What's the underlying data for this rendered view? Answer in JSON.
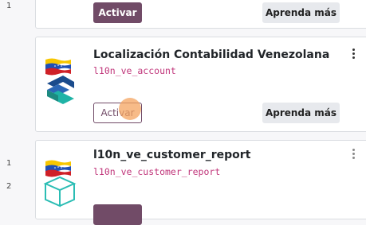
{
  "gutter": {
    "line_1": "1",
    "line_2": "1",
    "line_3": "2"
  },
  "cards": [
    {
      "activate_label": "Activar",
      "learn_more_label": "Aprenda más"
    },
    {
      "title": "Localización Contabilidad Venezolana",
      "technical_name": "l10n_ve_account",
      "activate_label": "Activar",
      "learn_more_label": "Aprenda más",
      "icon": "venezuela-flag-accounting-icon"
    },
    {
      "title": "l10n_ve_customer_report",
      "technical_name": "l10n_ve_customer_report",
      "icon": "venezuela-flag-box-icon"
    }
  ],
  "colors": {
    "primary": "#714b67",
    "technical_name": "#c0357a",
    "secondary_button": "#e7e9ed",
    "click_indicator": "#f4a460"
  }
}
